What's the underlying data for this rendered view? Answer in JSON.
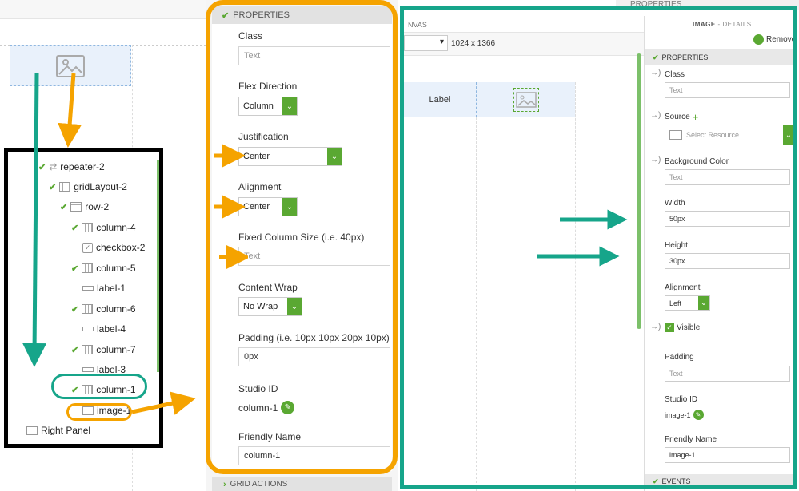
{
  "left": {
    "tree": [
      {
        "label": "repeater-2",
        "icon": "repeater-icon"
      },
      {
        "label": "gridLayout-2",
        "icon": "grid-icon"
      },
      {
        "label": "row-2",
        "icon": "row-icon"
      },
      {
        "label": "column-4",
        "icon": "column-icon"
      },
      {
        "label": "checkbox-2",
        "icon": "checkbox-icon"
      },
      {
        "label": "column-5",
        "icon": "column-icon"
      },
      {
        "label": "label-1",
        "icon": "label-icon"
      },
      {
        "label": "column-6",
        "icon": "column-icon"
      },
      {
        "label": "label-4",
        "icon": "label-icon"
      },
      {
        "label": "column-7",
        "icon": "column-icon"
      },
      {
        "label": "label-3",
        "icon": "label-icon"
      },
      {
        "label": "column-1",
        "icon": "column-icon"
      },
      {
        "label": "image-1",
        "icon": "image-icon"
      },
      {
        "label": "Right Panel",
        "icon": "panel-icon"
      }
    ]
  },
  "middle": {
    "header": "PROPERTIES",
    "class_label": "Class",
    "class_placeholder": "Text",
    "flex_label": "Flex Direction",
    "flex_value": "Column",
    "just_label": "Justification",
    "just_value": "Center",
    "align_label": "Alignment",
    "align_value": "Center",
    "fixed_label": "Fixed Column Size (i.e. 40px)",
    "fixed_placeholder": "Text",
    "wrap_label": "Content Wrap",
    "wrap_value": "No Wrap",
    "padding_label": "Padding (i.e. 10px 10px 20px 10px)",
    "padding_value": "0px",
    "studio_label": "Studio ID",
    "studio_value": "column-1",
    "friendly_label": "Friendly Name",
    "friendly_value": "column-1",
    "footer": "GRID ACTIONS"
  },
  "right": {
    "top_header": "PROPERTIES",
    "canvas_label": "NVAS",
    "resolution": "1024 x 1366",
    "canvas_cell_label": "Label",
    "panel_title": "IMAGE",
    "panel_subtitle": "- DETAILS",
    "remove": "Remove",
    "props_header": "PROPERTIES",
    "class_label": "Class",
    "class_placeholder": "Text",
    "source_label": "Source",
    "source_placeholder": "Select Resource...",
    "bg_label": "Background Color",
    "bg_placeholder": "Text",
    "width_label": "Width",
    "width_value": "50px",
    "height_label": "Height",
    "height_value": "30px",
    "align_label": "Alignment",
    "align_value": "Left",
    "visible_label": "Visible",
    "padding_label": "Padding",
    "padding_placeholder": "Text",
    "studio_label": "Studio ID",
    "studio_value": "image-1",
    "friendly_label": "Friendly Name",
    "friendly_value": "image-1",
    "events_header": "EVENTS"
  },
  "colors": {
    "orange": "#f5a300",
    "teal": "#16a58a",
    "green": "#5aa832",
    "black": "#000000"
  }
}
